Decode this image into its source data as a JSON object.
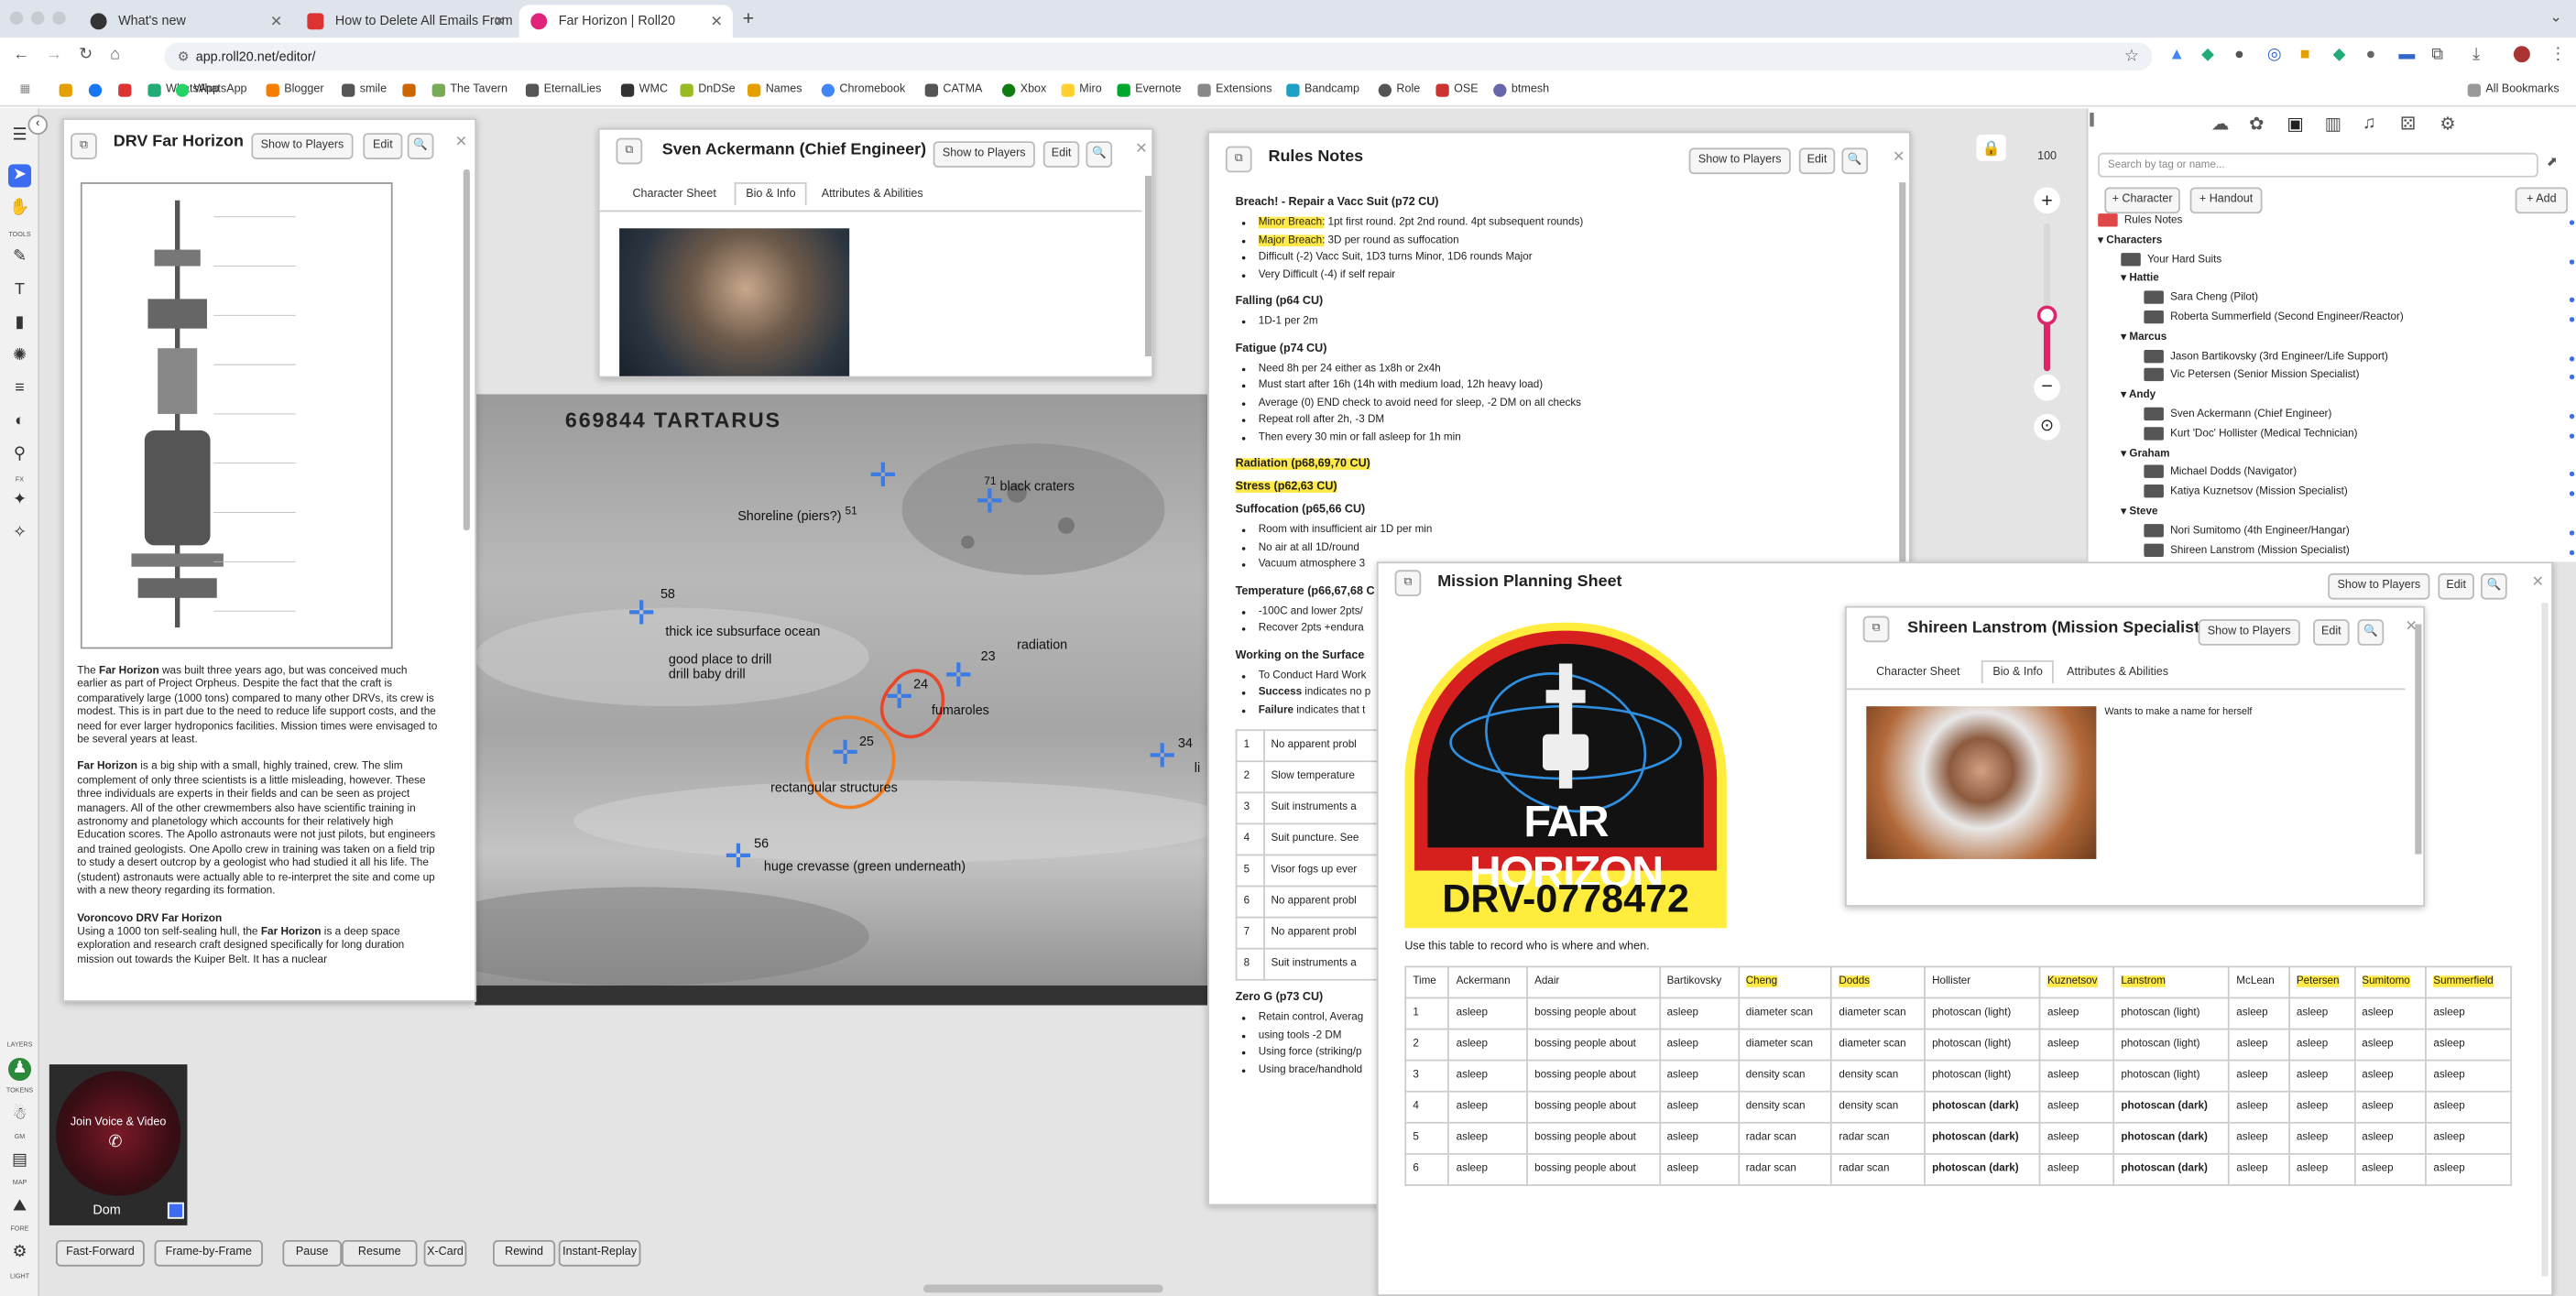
{
  "browser": {
    "tabs": [
      {
        "label": "What's new",
        "active": false
      },
      {
        "label": "How to Delete All Emails From",
        "active": false
      },
      {
        "label": "Far Horizon | Roll20",
        "active": true
      }
    ],
    "url": "app.roll20.net/editor/",
    "bookmarks": [
      "",
      "",
      "",
      "WhatsApp",
      "Blogger",
      "smile",
      "",
      "The Tavern",
      "EternalLies",
      "WMC",
      "DnDSe",
      "Names",
      "Chromebook",
      "CATMA",
      "Xbox",
      "Miro",
      "Evernote",
      "Extensions",
      "Bandcamp",
      "Role",
      "OSE",
      "btmesh"
    ],
    "all_bookmarks": "All Bookmarks"
  },
  "tools": {
    "labels": [
      "TOOLS",
      "FX",
      "LAYERS",
      "TOKENS",
      "GM",
      "MAP",
      "FORE",
      "LIGHT"
    ]
  },
  "drv": {
    "title": "DRV Far Horizon",
    "show": "Show to Players",
    "edit": "Edit",
    "p1_pre": "The ",
    "p1_bold": "Far Horizon",
    "p1": " was built three years ago, but was conceived much earlier as part of Project Orpheus. Despite the fact that the craft is comparatively large (1000 tons) compared to many other DRVs, its crew is modest. This is in part due to the need to reduce life support costs, and the need for ever larger hydroponics facilities. Mission times were envisaged to be several years at least.",
    "p2_bold": "Far Horizon",
    "p2": " is a big ship with a small, highly trained, crew. The slim complement of only three scientists is a little misleading, however. These three individuals are experts in their fields and can be seen as project managers. All of the other crewmembers also have scientific training in astronomy and planetology which accounts for their relatively high Education scores. The Apollo astronauts were not just pilots, but engineers and trained geologists. One Apollo crew in training was taken on a field trip to study a desert outcrop by a geologist who had studied it all his life. The (student) astronauts were actually able to re-interpret the site and come up with a new theory regarding its formation.",
    "h3": "Voroncovo DRV Far Horizon",
    "p3_pre": "Using a 1000 ton self-sealing hull, the ",
    "p3_bold": "Far Horizon",
    "p3": " is a deep space exploration and research craft designed specifically for long duration mission out towards the Kuiper Belt. It has a nuclear"
  },
  "sven": {
    "title": "Sven Ackermann (Chief Engineer)",
    "show": "Show to Players",
    "edit": "Edit",
    "tabs": [
      "Character Sheet",
      "Bio & Info",
      "Attributes & Abilities"
    ]
  },
  "map": {
    "title": "669844  TARTARUS",
    "labels": [
      {
        "num": "51",
        "text": "Shoreline (piers?)"
      },
      {
        "num": "71",
        "text": "black craters"
      },
      {
        "num": "58",
        "text": "thick ice subsurface ocean"
      },
      {
        "num": "",
        "text": "good place to drill\ndrill baby drill"
      },
      {
        "num": "23",
        "text": "radiation"
      },
      {
        "num": "24",
        "text": "fumaroles"
      },
      {
        "num": "25",
        "text": "rectangular structures"
      },
      {
        "num": "34",
        "text": "li"
      },
      {
        "num": "56",
        "text": "huge crevasse (green underneath)"
      }
    ]
  },
  "rules": {
    "title": "Rules Notes",
    "show": "Show to Players",
    "edit": "Edit",
    "breach": "Breach! - Repair a Vacc Suit (p72 CU)",
    "minor_l": "Minor Breach:",
    "minor": " 1pt first round. 2pt 2nd round. 4pt subsequent rounds)",
    "major_l": "Major Breach:",
    "major": " 3D per round as suffocation",
    "b3": "Difficult (-2) Vacc Suit, 1D3 turns Minor, 1D6 rounds Major",
    "b4": "Very Difficult (-4) if self repair",
    "falling": "Falling (p64 CU)",
    "f1": "1D-1 per 2m",
    "fatigue": "Fatigue (p74 CU)",
    "fa": [
      "Need 8h per 24 either as 1x8h or 2x4h",
      "Must start after 16h (14h with medium load, 12h heavy load)",
      "Average (0) END check to avoid need for sleep, -2 DM on all checks",
      "Repeat roll after 2h, -3 DM",
      "Then every 30 min or fall asleep for 1h min"
    ],
    "radiation": "Radiation (p68,69,70 CU)",
    "stress": "Stress (p62,63 CU)",
    "suffocation": "Suffocation (p65,66 CU)",
    "su": [
      "Room with insufficient air 1D per min",
      "No air at all 1D/round",
      "Vacuum atmosphere 3"
    ],
    "temp": "Temperature (p66,67,68 C",
    "te": [
      "-100C and lower 2pts/",
      "Recover 2pts +endura"
    ],
    "work": "Working on the Surface",
    "wo_pre": "To Conduct Hard Work",
    "success_b": "Success",
    "success": " indicates no p",
    "failure_b": "Failure",
    "failure": " indicates that t",
    "rows": [
      [
        "1",
        "No apparent probl"
      ],
      [
        "2",
        "Slow temperature"
      ],
      [
        "3",
        "Suit instruments a"
      ],
      [
        "4",
        "Suit puncture. See"
      ],
      [
        "5",
        "Visor fogs up ever"
      ],
      [
        "6",
        "No apparent probl"
      ],
      [
        "7",
        "No apparent probl"
      ],
      [
        "8",
        "Suit instruments a"
      ]
    ],
    "zerog": "Zero G (p73 CU)",
    "zg": [
      "Retain control, Averag",
      "using tools -2 DM",
      "Using force (striking/p",
      "Using brace/handhold"
    ]
  },
  "mission": {
    "title": "Mission Planning Sheet",
    "show": "Show to Players",
    "edit": "Edit",
    "logo_top": "FAR HORIZON",
    "logo_bottom": "DRV-0778472",
    "caption": "Use this table to record who is where and when.",
    "headers": [
      "Time",
      "Ackermann",
      "Adair",
      "Bartikovsky",
      "Cheng",
      "Dodds",
      "Hollister",
      "Kuznetsov",
      "Lanstrom",
      "McLean",
      "Petersen",
      "Sumitomo",
      "Summerfield"
    ],
    "rows": [
      [
        "1",
        "asleep",
        "bossing people about",
        "asleep",
        "diameter scan",
        "diameter scan",
        "photoscan (light)",
        "asleep",
        "photoscan (light)",
        "asleep",
        "asleep",
        "asleep",
        "asleep"
      ],
      [
        "2",
        "asleep",
        "bossing people about",
        "asleep",
        "diameter scan",
        "diameter scan",
        "photoscan (light)",
        "asleep",
        "photoscan  (light)",
        "asleep",
        "asleep",
        "asleep",
        "asleep"
      ],
      [
        "3",
        "asleep",
        "bossing people about",
        "asleep",
        "density scan",
        "density scan",
        "photoscan (light)",
        "asleep",
        "photoscan (light)",
        "asleep",
        "asleep",
        "asleep",
        "asleep"
      ],
      [
        "4",
        "asleep",
        "bossing people about",
        "asleep",
        "density scan",
        "density scan",
        "photoscan (dark)",
        "asleep",
        "photoscan (dark)",
        "asleep",
        "asleep",
        "asleep",
        "asleep"
      ],
      [
        "5",
        "asleep",
        "bossing people about",
        "asleep",
        "radar scan",
        "radar scan",
        "photoscan (dark)",
        "asleep",
        "photoscan (dark)",
        "asleep",
        "asleep",
        "asleep",
        "asleep"
      ],
      [
        "6",
        "asleep",
        "bossing people about",
        "asleep",
        "radar scan",
        "radar scan",
        "photoscan (dark)",
        "asleep",
        "photoscan (dark)",
        "asleep",
        "asleep",
        "asleep",
        "asleep"
      ]
    ]
  },
  "shireen": {
    "title": "Shireen Lanstrom (Mission Specialist)",
    "show": "Show to Players",
    "edit": "Edit",
    "tabs": [
      "Character Sheet",
      "Bio & Info",
      "Attributes & Abilities"
    ],
    "bio": "Wants to make a name for herself"
  },
  "right": {
    "search_placeholder": "Search by tag or name...",
    "add_character": "+ Character",
    "add_handout": "+ Handout",
    "add": "+ Add",
    "tree": [
      {
        "t": "Rules Notes",
        "lvl": 0,
        "k": "h"
      },
      {
        "t": "Characters",
        "lvl": 0,
        "k": "f"
      },
      {
        "t": "Your Hard Suits",
        "lvl": 1,
        "k": "i"
      },
      {
        "t": "Hattie",
        "lvl": 1,
        "k": "f"
      },
      {
        "t": "Sara Cheng (Pilot)",
        "lvl": 2,
        "k": "i"
      },
      {
        "t": "Roberta Summerfield (Second Engineer/Reactor)",
        "lvl": 2,
        "k": "i"
      },
      {
        "t": "Marcus",
        "lvl": 1,
        "k": "f"
      },
      {
        "t": "Jason Bartikovsky (3rd Engineer/Life Support)",
        "lvl": 2,
        "k": "i"
      },
      {
        "t": "Vic Petersen (Senior Mission Specialist)",
        "lvl": 2,
        "k": "i"
      },
      {
        "t": "Andy",
        "lvl": 1,
        "k": "f"
      },
      {
        "t": "Sven Ackermann (Chief Engineer)",
        "lvl": 2,
        "k": "i"
      },
      {
        "t": "Kurt 'Doc' Hollister (Medical Technician)",
        "lvl": 2,
        "k": "i"
      },
      {
        "t": "Graham",
        "lvl": 1,
        "k": "f"
      },
      {
        "t": "Michael Dodds (Navigator)",
        "lvl": 2,
        "k": "i"
      },
      {
        "t": "Katiya Kuznetsov (Mission Specialist)",
        "lvl": 2,
        "k": "i"
      },
      {
        "t": "Steve",
        "lvl": 1,
        "k": "f"
      },
      {
        "t": "Nori Sumitomo (4th Engineer/Hangar)",
        "lvl": 2,
        "k": "i"
      },
      {
        "t": "Shireen Lanstrom (Mission Specialist)",
        "lvl": 2,
        "k": "i"
      }
    ]
  },
  "zoom": "100",
  "voice": {
    "join": "Join Voice & Video",
    "player": "Dom"
  },
  "controls": [
    "Fast-Forward",
    "Frame-by-Frame",
    "Pause",
    "Resume",
    "X-Card",
    "Rewind",
    "Instant-Replay"
  ]
}
